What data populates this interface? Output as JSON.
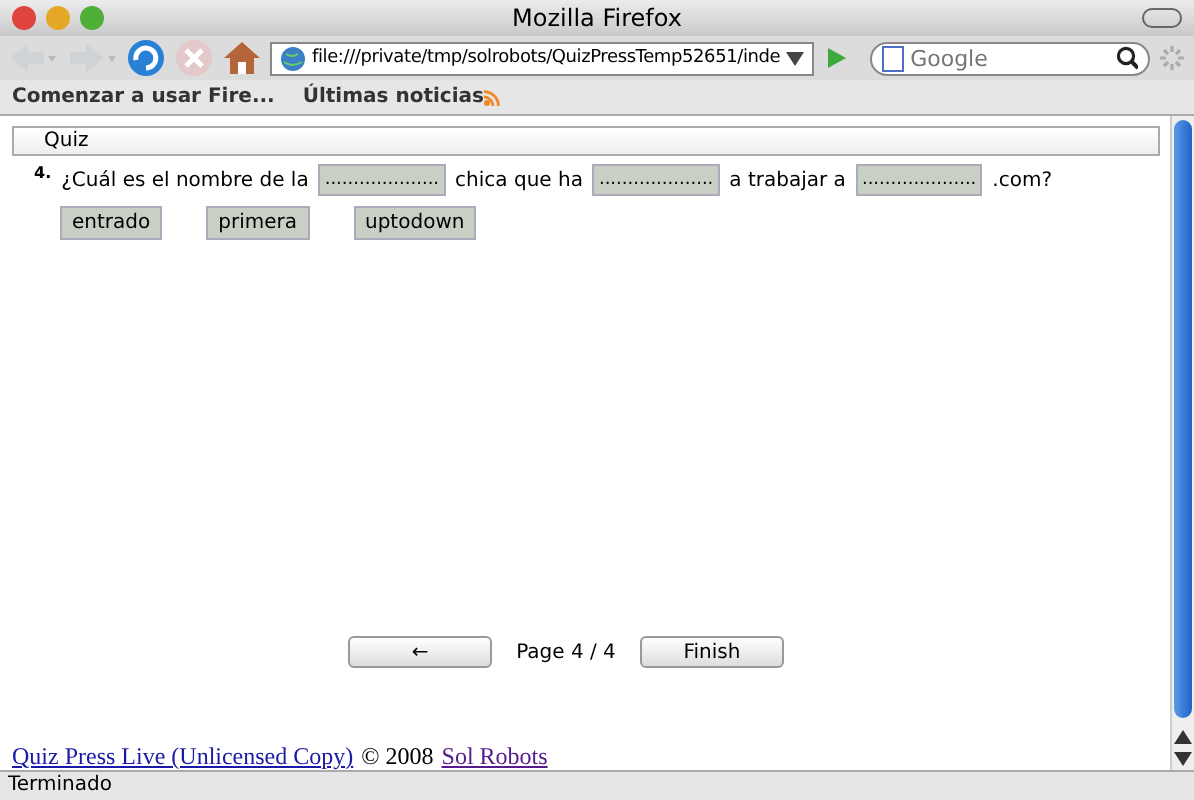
{
  "window": {
    "title": "Mozilla Firefox"
  },
  "toolbar": {
    "address": "file:///private/tmp/solrobots/QuizPressTemp52651/inde",
    "search": {
      "placeholder": "Google"
    }
  },
  "bookmarks": [
    "Comenzar a usar Fire...",
    "Últimas noticias"
  ],
  "quiz": {
    "header": "Quiz",
    "number": "4.",
    "parts": [
      {
        "kind": "text",
        "text": "¿Cuál es el nombre de la"
      },
      {
        "kind": "blank",
        "text": "...................."
      },
      {
        "kind": "text",
        "text": "chica que ha"
      },
      {
        "kind": "blank",
        "text": "...................."
      },
      {
        "kind": "text",
        "text": "a trabajar a"
      },
      {
        "kind": "blank",
        "text": "...................."
      },
      {
        "kind": "text",
        "text": ".com?"
      }
    ],
    "choices": [
      "entrado",
      "primera",
      "uptodown"
    ]
  },
  "nav": {
    "back": "←",
    "page": "Page 4 / 4",
    "finish": "Finish"
  },
  "footer": {
    "link": "Quiz Press Live (Unlicensed Copy)",
    "text": "© 2008",
    "owner": "Sol Robots"
  },
  "status_bar": "Terminado"
}
